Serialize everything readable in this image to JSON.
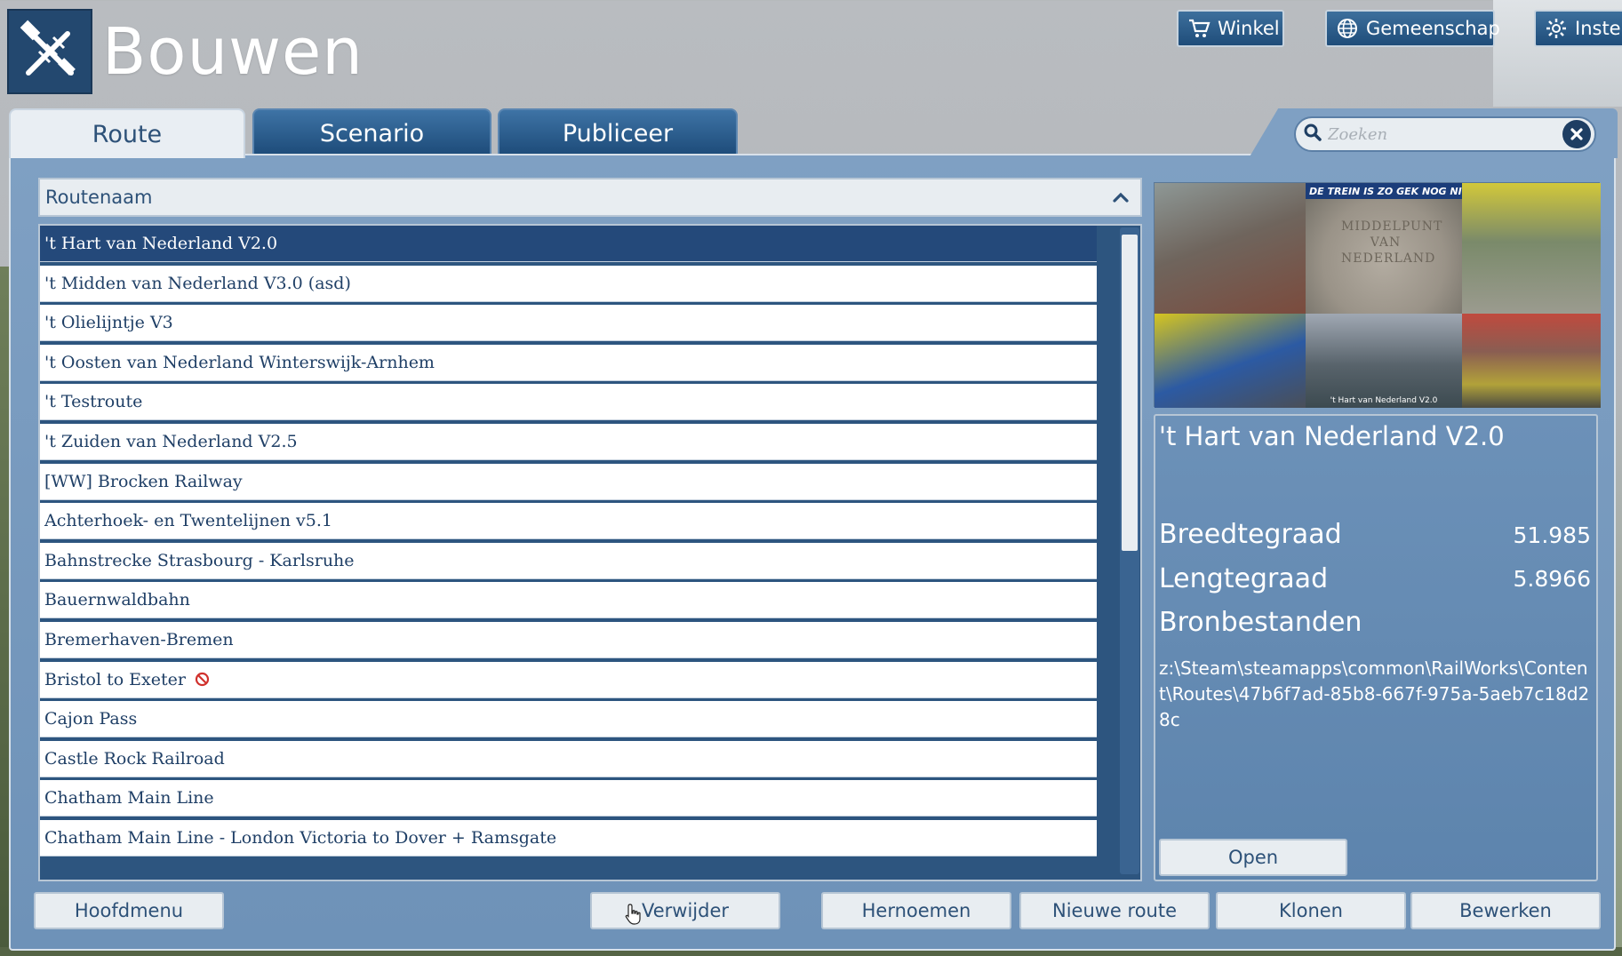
{
  "app": {
    "title": "Bouwen",
    "icon": "hammer-track-icon"
  },
  "top_nav": [
    {
      "label": "Winkel",
      "icon": "cart-icon"
    },
    {
      "label": "Gemeenschap",
      "icon": "globe-icon"
    },
    {
      "label": "Instel",
      "icon": "gear-icon"
    }
  ],
  "tabs": [
    {
      "label": "Route",
      "active": true
    },
    {
      "label": "Scenario",
      "active": false
    },
    {
      "label": "Publiceer",
      "active": false
    }
  ],
  "search": {
    "placeholder": "Zoeken",
    "value": ""
  },
  "list": {
    "column_header": "Routenaam",
    "routes": [
      {
        "name": "'t Hart van Nederland V2.0",
        "selected": true
      },
      {
        "name": "'t Midden van Nederland V3.0 (asd)"
      },
      {
        "name": "'t Olielijntje V3"
      },
      {
        "name": "'t Oosten van Nederland Winterswijk-Arnhem"
      },
      {
        "name": "'t Testroute"
      },
      {
        "name": "'t Zuiden van Nederland V2.5"
      },
      {
        "name": "[WW] Brocken Railway"
      },
      {
        "name": "Achterhoek- en Twentelijnen v5.1"
      },
      {
        "name": "Bahnstrecke Strasbourg - Karlsruhe"
      },
      {
        "name": "Bauernwaldbahn"
      },
      {
        "name": "Bremerhaven-Bremen"
      },
      {
        "name": "Bristol to Exeter",
        "forbidden": true
      },
      {
        "name": "Cajon Pass"
      },
      {
        "name": "Castle Rock Railroad"
      },
      {
        "name": "Chatham Main Line"
      },
      {
        "name": "Chatham Main Line - London Victoria to Dover + Ramsgate"
      }
    ]
  },
  "preview": {
    "banner": "DE TREIN IS ZO GEK NOG NIET",
    "stone_text": "MIDDELPUNT VAN NEDERLAND",
    "caption": "'t Hart van Nederland V2.0"
  },
  "details": {
    "title": "'t Hart van Nederland V2.0",
    "latitude_label": "Breedtegraad",
    "latitude_value": "51.985",
    "longitude_label": "Lengtegraad",
    "longitude_value": "5.8966",
    "sources_label": "Bronbestanden",
    "source_path": "z:\\Steam\\steamapps\\common\\RailWorks\\Content\\Routes\\47b6f7ad-85b8-667f-975a-5aeb7c18d28c",
    "open_label": "Open"
  },
  "actions": {
    "main_menu": "Hoofdmenu",
    "delete": "Verwijder",
    "rename": "Hernoemen",
    "new_route": "Nieuwe route",
    "clone": "Klonen",
    "edit": "Bewerken"
  },
  "colors": {
    "accent": "#24497a",
    "panel": "#7fa0c3",
    "tab_inactive": "#1c4a78"
  }
}
